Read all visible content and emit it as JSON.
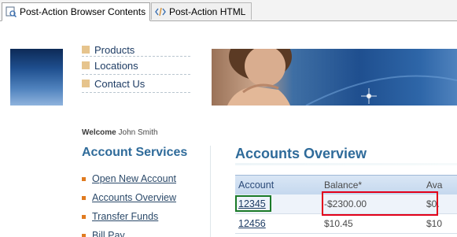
{
  "tabs": [
    {
      "label": "Post-Action Browser Contents",
      "icon": "browser-page-icon",
      "active": true
    },
    {
      "label": "Post-Action HTML",
      "icon": "html-source-icon",
      "active": false
    }
  ],
  "menu": {
    "items": [
      "Products",
      "Locations",
      "Contact Us"
    ]
  },
  "welcome": {
    "prefix": "Welcome",
    "user": "John Smith"
  },
  "services": {
    "title": "Account Services",
    "links": [
      "Open New Account",
      "Accounts Overview",
      "Transfer Funds",
      "Bill Pay"
    ]
  },
  "overview": {
    "title": "Accounts Overview",
    "headers": {
      "account": "Account",
      "balance": "Balance*",
      "available": "Ava"
    },
    "rows": [
      {
        "account": "12345",
        "balance": "-$2300.00",
        "available": "$0."
      },
      {
        "account": "12456",
        "balance": "$10.45",
        "available": "$10"
      }
    ]
  },
  "colors": {
    "accent_title": "#2f6b9a",
    "highlight_account": "#1a7a28",
    "highlight_balance": "#e2001a",
    "bullet": "#e07b20"
  }
}
